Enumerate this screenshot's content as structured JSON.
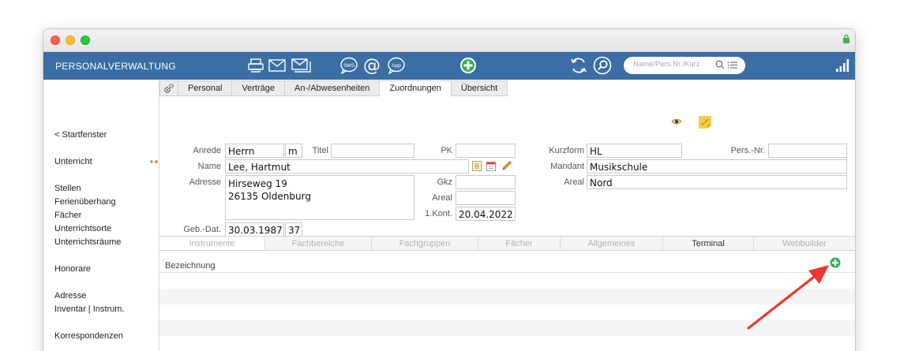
{
  "app": {
    "title": "PERSONALVERWALTUNG",
    "search_placeholder": "Name/Pers.Nr./Kurz",
    "accent": "#3a6ea5"
  },
  "toolbar": {
    "icons": [
      "printer-icon",
      "mail-icon",
      "mail-stack-icon",
      "sms-icon",
      "at-icon",
      "app-icon",
      "add-icon",
      "refresh-icon",
      "search-icon",
      "list-icon",
      "stats-icon"
    ],
    "sms_label": "SMS",
    "at_label": "@",
    "app_label": "App"
  },
  "sidebar": {
    "items": [
      {
        "label": "< Startfenster"
      },
      {
        "label": "Unterricht"
      },
      {
        "label": "Stellen"
      },
      {
        "label": "Ferienüberhang"
      },
      {
        "label": "Fächer"
      },
      {
        "label": "Unterrichtsorte"
      },
      {
        "label": "Unterrichtsräume"
      },
      {
        "label": "Honorare"
      },
      {
        "label": "Adresse"
      },
      {
        "label": "Inventar | Instrum."
      },
      {
        "label": "Korrespondenzen"
      }
    ]
  },
  "tabs": [
    {
      "label": "Personal"
    },
    {
      "label": "Verträge"
    },
    {
      "label": "An-/Abwesenheiten"
    },
    {
      "label": "Zuordnungen",
      "active": true
    },
    {
      "label": "Übersicht"
    }
  ],
  "form": {
    "anrede_label": "Anrede",
    "anrede": "Herrn",
    "gender": "m",
    "titel_label": "Titel",
    "titel": "",
    "pk_label": "PK",
    "pk": "",
    "name_label": "Name",
    "name": "Lee, Hartmut",
    "adresse_label": "Adresse",
    "adresse_line1": "Hirseweg 19",
    "adresse_line2": "26135 Oldenburg",
    "gkz_label": "Gkz",
    "gkz": "",
    "areal_label": "Areal",
    "areal": "",
    "kont_label": "1.Kont.",
    "kont": "20.04.2022",
    "gebdat_label": "Geb.-Dat.",
    "gebdat": "30.03.1987",
    "alter": "37",
    "kurzform_label": "Kurzform",
    "kurzform": "HL",
    "persnr_label": "Pers.-Nr.",
    "persnr": "",
    "mandant_label": "Mandant",
    "mandant": "Musikschule",
    "areal2_label": "Areal",
    "areal2": "Nord"
  },
  "subtabs": [
    {
      "label": "Instrumente"
    },
    {
      "label": "Fachbereiche"
    },
    {
      "label": "Fachgruppen"
    },
    {
      "label": "Fächer"
    },
    {
      "label": "Allgemeines"
    },
    {
      "label": "Terminal"
    },
    {
      "label": "Webbuilder"
    }
  ],
  "table": {
    "column": "Bezeichnung"
  }
}
